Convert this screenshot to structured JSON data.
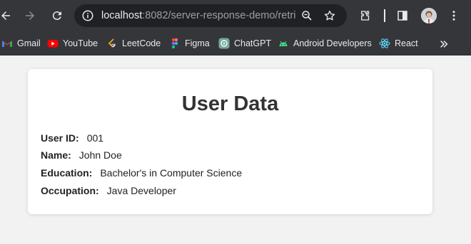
{
  "browser": {
    "url_host": "localhost",
    "url_rest": ":8082/server-response-demo/retri..."
  },
  "bookmarks": [
    {
      "label": "Gmail",
      "icon": "gmail-icon"
    },
    {
      "label": "YouTube",
      "icon": "youtube-icon"
    },
    {
      "label": "LeetCode",
      "icon": "leetcode-icon"
    },
    {
      "label": "Figma",
      "icon": "figma-icon"
    },
    {
      "label": "ChatGPT",
      "icon": "chatgpt-icon"
    },
    {
      "label": "Android Developers",
      "icon": "android-icon"
    },
    {
      "label": "React",
      "icon": "react-icon"
    }
  ],
  "page": {
    "title": "User Data",
    "fields": [
      {
        "label": "User ID:",
        "value": "001"
      },
      {
        "label": "Name:",
        "value": "John Doe"
      },
      {
        "label": "Education:",
        "value": "Bachelor's in Computer Science"
      },
      {
        "label": "Occupation:",
        "value": "Java Developer"
      }
    ]
  },
  "colors": {
    "chrome_bg": "#35363a",
    "omnibox_bg": "#202124",
    "page_bg": "#f2f2f2",
    "card_bg": "#ffffff",
    "title_color": "#333333"
  }
}
